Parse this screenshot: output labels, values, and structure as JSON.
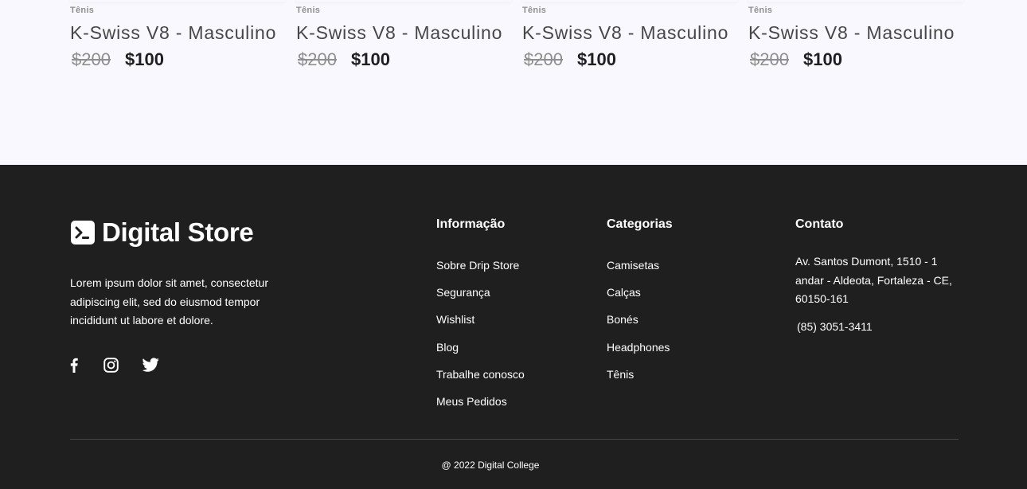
{
  "products": [
    {
      "category": "Tênis",
      "name": "K-Swiss V8 - Masculino",
      "old_price": "$200",
      "new_price": "$100"
    },
    {
      "category": "Tênis",
      "name": "K-Swiss V8 - Masculino",
      "old_price": "$200",
      "new_price": "$100"
    },
    {
      "category": "Tênis",
      "name": "K-Swiss V8 - Masculino",
      "old_price": "$200",
      "new_price": "$100"
    },
    {
      "category": "Tênis",
      "name": "K-Swiss V8 - Masculino",
      "old_price": "$200",
      "new_price": "$100"
    }
  ],
  "footer": {
    "brand": {
      "name": "Digital Store",
      "logo_icon": "terminal-prompt-icon"
    },
    "description": "Lorem ipsum dolor sit amet, consectetur adipiscing elit, sed do eiusmod tempor incididunt ut labore et dolore.",
    "socials": [
      {
        "icon": "facebook-icon"
      },
      {
        "icon": "instagram-icon"
      },
      {
        "icon": "twitter-icon"
      }
    ],
    "info": {
      "title": "Informação",
      "items": [
        "Sobre Drip Store",
        "Segurança",
        "Wishlist",
        "Blog",
        "Trabalhe conosco",
        "Meus Pedidos"
      ]
    },
    "categories": {
      "title": "Categorias",
      "items": [
        "Camisetas",
        "Calças",
        "Bonés",
        "Headphones",
        "Tênis"
      ]
    },
    "contact": {
      "title": "Contato",
      "address": "Av. Santos Dumont, 1510 - 1 andar - Aldeota, Fortaleza - CE, 60150-161",
      "phone": "(85) 3051-3411"
    },
    "copyright": "@ 2022 Digital College"
  },
  "colors": {
    "products_background": "#F9F8FE",
    "footer_background": "#1F1F1F",
    "text_dark": "#1F1F1F",
    "text_muted": "#8F8F8F",
    "divider": "#474747"
  }
}
